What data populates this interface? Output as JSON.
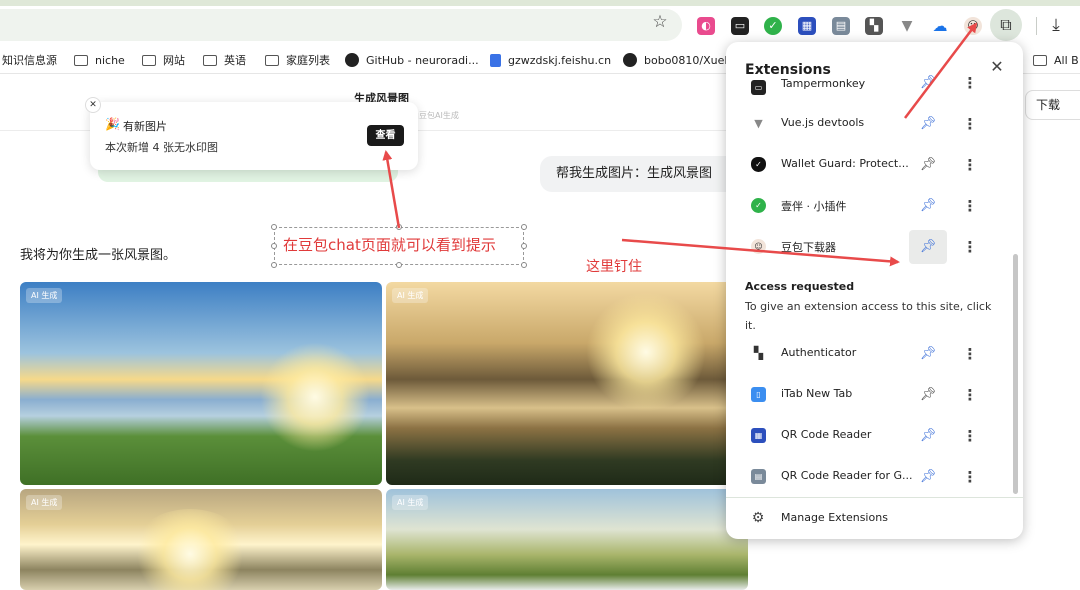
{
  "browser": {
    "extension_toolbar_icons": [
      "tampermonkey-icon",
      "pdf-icon",
      "vue-icon",
      "qr-reader-icon",
      "qr-reader-g-icon",
      "authenticator-icon",
      "vuejs-devtools-icon",
      "cloud-download-icon",
      "doubao-downloader-icon"
    ],
    "bookmarks": [
      {
        "label": "知识信息源",
        "icon": "none"
      },
      {
        "label": "niche",
        "icon": "folder-icon"
      },
      {
        "label": "网站",
        "icon": "folder-icon"
      },
      {
        "label": "英语",
        "icon": "folder-icon"
      },
      {
        "label": "家庭列表",
        "icon": "folder-icon"
      },
      {
        "label": "GitHub - neuroradi...",
        "icon": "github-icon"
      },
      {
        "label": "gzwzdskj.feishu.cn",
        "icon": "doc-icon"
      },
      {
        "label": "bobo0810/XueL",
        "icon": "github-icon"
      },
      {
        "label": "All B",
        "icon": "folder-icon"
      }
    ]
  },
  "page": {
    "title": "生成风景图",
    "subtitle": "内容由豆包AI生成",
    "download_label": "下载",
    "toast": {
      "emoji": "🎉",
      "title": "有新图片",
      "body": "本次新增 4 张无水印图",
      "button": "查看"
    },
    "user_message": "帮我生成图片：生成风景图",
    "assistant_reply": "我将为你生成一张风景图。",
    "image_badge": "AI 生成"
  },
  "annotations": {
    "box_text": "在豆包chat页面就可以看到提示",
    "pin_text": "这里钉住",
    "arrow_color": "#e84a4a"
  },
  "extensions_popup": {
    "title": "Extensions",
    "items": [
      {
        "name": "Tampermonkey",
        "pinned": false
      },
      {
        "name": "Vue.js devtools",
        "pinned": false
      },
      {
        "name": "Wallet Guard: Protect...",
        "pinned": true
      },
      {
        "name": "壹伴 · 小插件",
        "pinned": false
      },
      {
        "name": "豆包下载器",
        "pinned": false
      }
    ],
    "access_title": "Access requested",
    "access_desc": "To give an extension access to this site, click it.",
    "access_items": [
      {
        "name": "Authenticator",
        "pinned": false
      },
      {
        "name": "iTab New Tab",
        "pinned": true
      },
      {
        "name": "QR Code Reader",
        "pinned": false
      },
      {
        "name": "QR Code Reader for G...",
        "pinned": false
      }
    ],
    "manage_label": "Manage Extensions"
  }
}
